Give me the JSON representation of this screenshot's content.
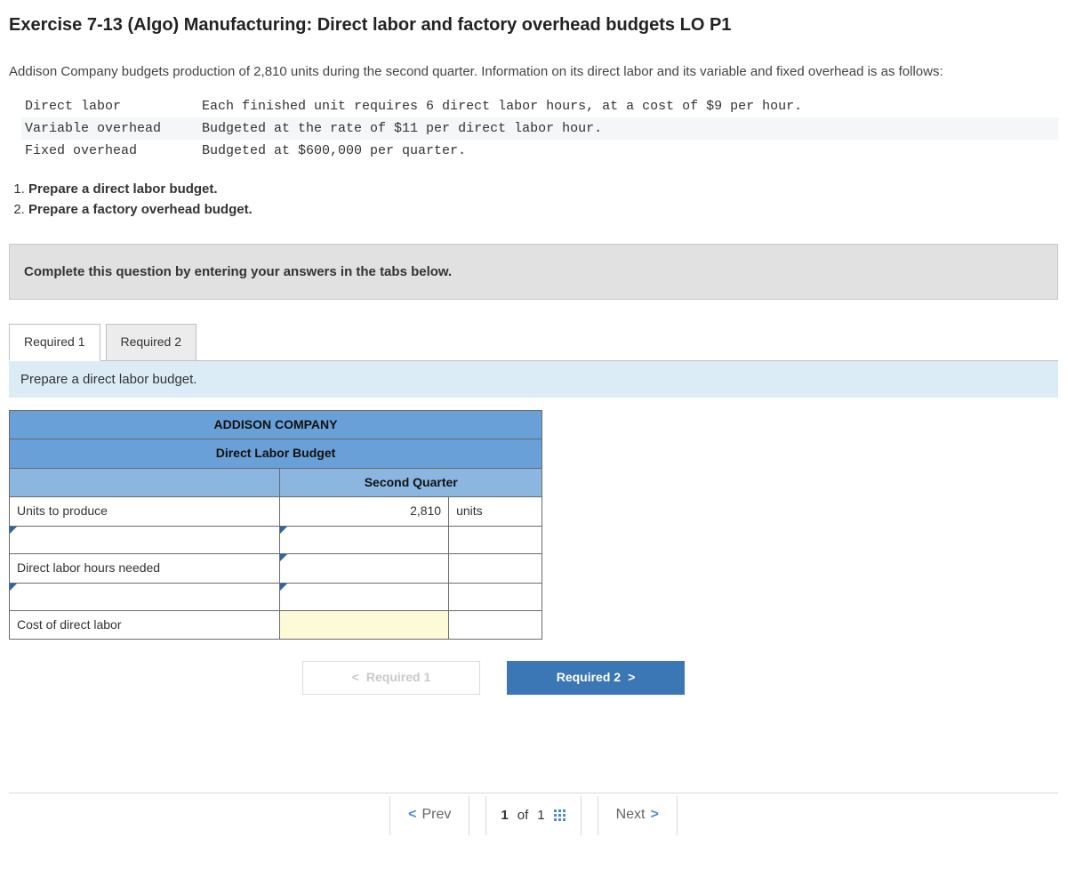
{
  "title": "Exercise 7-13 (Algo) Manufacturing: Direct labor and factory overhead budgets LO P1",
  "intro": "Addison Company budgets production of 2,810 units during the second quarter. Information on its direct labor and its variable and fixed overhead is as follows:",
  "info": {
    "rows": [
      {
        "label": "Direct labor",
        "desc": "Each finished unit requires 6 direct labor hours, at a cost of $9 per hour."
      },
      {
        "label": "Variable overhead",
        "desc": "Budgeted at the rate of $11 per direct labor hour."
      },
      {
        "label": "Fixed overhead",
        "desc": "Budgeted at $600,000 per quarter."
      }
    ]
  },
  "tasks": [
    "Prepare a direct labor budget.",
    "Prepare a factory overhead budget."
  ],
  "instruction": "Complete this question by entering your answers in the tabs below.",
  "tabs": {
    "t1": "Required 1",
    "t2": "Required 2"
  },
  "tab_prompt": "Prepare a direct labor budget.",
  "table": {
    "company": "ADDISON COMPANY",
    "report": "Direct Labor Budget",
    "period": "Second Quarter",
    "rows": {
      "r1_label": "Units to produce",
      "r1_val": "2,810",
      "r1_unit": "units",
      "r3_label": "Direct labor hours needed",
      "r5_label": "Cost of direct labor"
    }
  },
  "navbtn": {
    "prev": "Required 1",
    "next": "Required 2"
  },
  "footer": {
    "prev": "Prev",
    "page_cur": "1",
    "page_of": "of",
    "page_tot": "1",
    "next": "Next"
  }
}
